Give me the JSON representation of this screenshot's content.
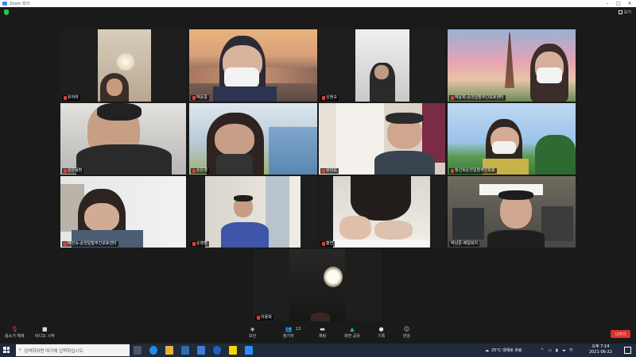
{
  "window": {
    "title": "Zoom 회의",
    "controls": [
      "–",
      "□",
      "✕"
    ]
  },
  "top": {
    "view_label": "보기",
    "security_icon": "shield-icon"
  },
  "participants": [
    {
      "name": "유아라"
    },
    {
      "name": "박윤중"
    },
    {
      "name": "신현규"
    },
    {
      "name": "박윤희-순천일발주간보호센터"
    },
    {
      "name": "손은용환"
    },
    {
      "name": "손은경"
    },
    {
      "name": "유이도"
    },
    {
      "name": "정선희순천일발주간보호"
    },
    {
      "name": "박민숙-순천일발주간보호센터"
    },
    {
      "name": "손영환"
    },
    {
      "name": "황연"
    },
    {
      "name": "박남준-애일복지"
    },
    {
      "name": "이용희"
    }
  ],
  "toolbar": {
    "mute": "음소거 해제",
    "video": "비디오 시작",
    "security": "보안",
    "participants": "참가자",
    "participants_count": "13",
    "chat": "채팅",
    "share": "화면 공유",
    "record": "기록",
    "reactions": "반응",
    "leave": "나가기"
  },
  "taskbar": {
    "search_placeholder": "검색하려면 여기에 입력하십시오.",
    "weather": "25°C 대체로 흐림",
    "time": "오후 7:14",
    "date": "2021-06-22",
    "ime": "가"
  },
  "colors": {
    "accent": "#2d8cff",
    "active_speaker": "#b4e33c",
    "leave": "#d9322e",
    "share": "#23c552"
  }
}
